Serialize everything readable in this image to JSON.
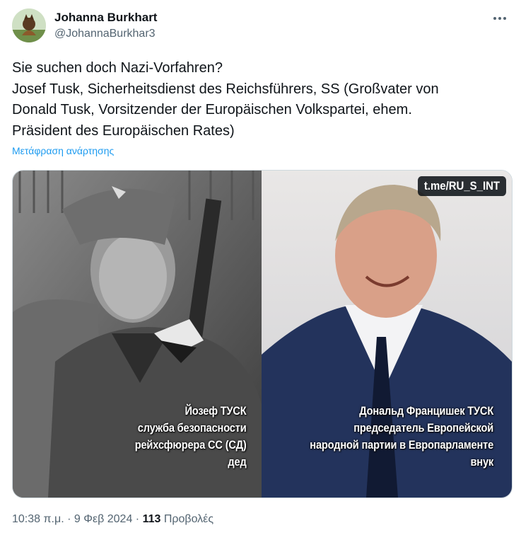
{
  "author": {
    "display_name": "Johanna Burkhart",
    "handle": "@JohannaBurkhar3"
  },
  "tweet": {
    "lines": [
      "Sie suchen doch Nazi-Vorfahren?",
      "Josef Tusk, Sicherheitsdienst des Reichsführers, SS (Großvater von",
      "Donald Tusk, Vorsitzender der Europäischen Volkspartei, ehem.",
      "Präsident des Europäischen Rates)"
    ],
    "translate_label": "Μετάφραση ανάρτησης"
  },
  "media": {
    "watermark": "t.me/RU_S_INT",
    "left_caption": [
      "Йозеф ТУСК",
      "служба безопасности",
      "рейхсфюрера СС (СД)",
      "дед"
    ],
    "right_caption": [
      "Дональд Францишек ТУСК",
      "председатель Европейской",
      "народной партии в Европарламенте",
      "внук"
    ]
  },
  "meta": {
    "time": "10:38 π.μ.",
    "separator": " · ",
    "date": "9 Φεβ 2024",
    "views_count": "113",
    "views_label": "Προβολές"
  },
  "colors": {
    "text": "#0f1419",
    "secondary": "#536471",
    "link": "#1d9bf0",
    "border": "#cfd9de"
  }
}
